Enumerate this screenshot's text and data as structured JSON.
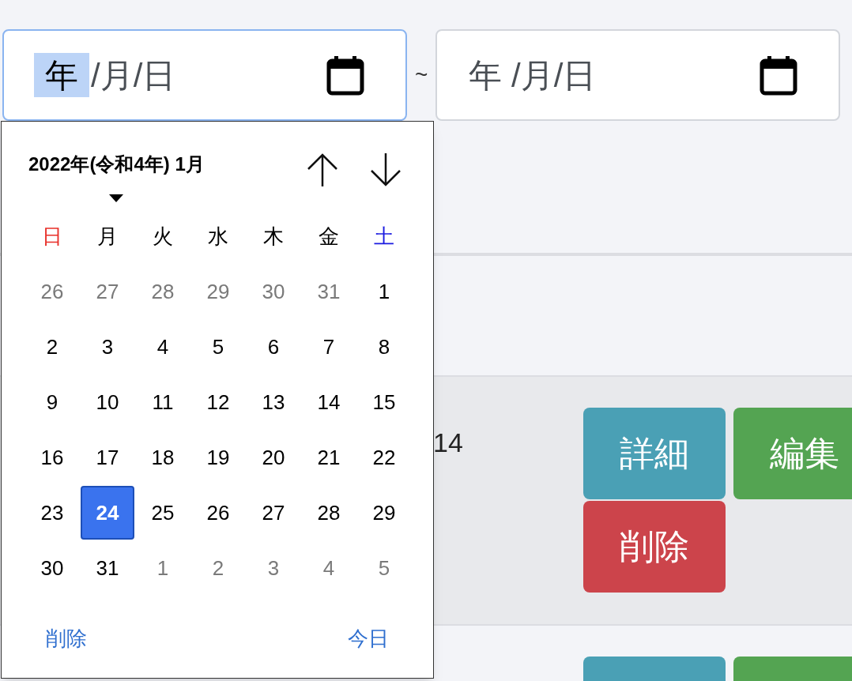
{
  "date_range": {
    "fields": [
      {
        "focused": true,
        "segments": [
          {
            "label": "年",
            "selected": true
          },
          {
            "label": "/月/日",
            "selected": false
          }
        ]
      },
      {
        "focused": false,
        "segments": [
          {
            "label": "年 /月/日",
            "selected": false
          }
        ]
      }
    ],
    "separator": "~"
  },
  "calendar": {
    "title": "2022年(令和4年) 1月",
    "weekdays": [
      {
        "label": "日",
        "color": "#e8302a"
      },
      {
        "label": "月",
        "color": "#000000"
      },
      {
        "label": "火",
        "color": "#000000"
      },
      {
        "label": "水",
        "color": "#000000"
      },
      {
        "label": "木",
        "color": "#000000"
      },
      {
        "label": "金",
        "color": "#000000"
      },
      {
        "label": "土",
        "color": "#1a1ae0"
      }
    ],
    "weeks": [
      [
        {
          "label": "26",
          "muted": true,
          "selected": false
        },
        {
          "label": "27",
          "muted": true,
          "selected": false
        },
        {
          "label": "28",
          "muted": true,
          "selected": false
        },
        {
          "label": "29",
          "muted": true,
          "selected": false
        },
        {
          "label": "30",
          "muted": true,
          "selected": false
        },
        {
          "label": "31",
          "muted": true,
          "selected": false
        },
        {
          "label": "1",
          "muted": false,
          "selected": false
        }
      ],
      [
        {
          "label": "2",
          "muted": false,
          "selected": false
        },
        {
          "label": "3",
          "muted": false,
          "selected": false
        },
        {
          "label": "4",
          "muted": false,
          "selected": false
        },
        {
          "label": "5",
          "muted": false,
          "selected": false
        },
        {
          "label": "6",
          "muted": false,
          "selected": false
        },
        {
          "label": "7",
          "muted": false,
          "selected": false
        },
        {
          "label": "8",
          "muted": false,
          "selected": false
        }
      ],
      [
        {
          "label": "9",
          "muted": false,
          "selected": false
        },
        {
          "label": "10",
          "muted": false,
          "selected": false
        },
        {
          "label": "11",
          "muted": false,
          "selected": false
        },
        {
          "label": "12",
          "muted": false,
          "selected": false
        },
        {
          "label": "13",
          "muted": false,
          "selected": false
        },
        {
          "label": "14",
          "muted": false,
          "selected": false
        },
        {
          "label": "15",
          "muted": false,
          "selected": false
        }
      ],
      [
        {
          "label": "16",
          "muted": false,
          "selected": false
        },
        {
          "label": "17",
          "muted": false,
          "selected": false
        },
        {
          "label": "18",
          "muted": false,
          "selected": false
        },
        {
          "label": "19",
          "muted": false,
          "selected": false
        },
        {
          "label": "20",
          "muted": false,
          "selected": false
        },
        {
          "label": "21",
          "muted": false,
          "selected": false
        },
        {
          "label": "22",
          "muted": false,
          "selected": false
        }
      ],
      [
        {
          "label": "23",
          "muted": false,
          "selected": false
        },
        {
          "label": "24",
          "muted": false,
          "selected": true
        },
        {
          "label": "25",
          "muted": false,
          "selected": false
        },
        {
          "label": "26",
          "muted": false,
          "selected": false
        },
        {
          "label": "27",
          "muted": false,
          "selected": false
        },
        {
          "label": "28",
          "muted": false,
          "selected": false
        },
        {
          "label": "29",
          "muted": false,
          "selected": false
        }
      ],
      [
        {
          "label": "30",
          "muted": false,
          "selected": false
        },
        {
          "label": "31",
          "muted": false,
          "selected": false
        },
        {
          "label": "1",
          "muted": true,
          "selected": false
        },
        {
          "label": "2",
          "muted": true,
          "selected": false
        },
        {
          "label": "3",
          "muted": true,
          "selected": false
        },
        {
          "label": "4",
          "muted": true,
          "selected": false
        },
        {
          "label": "5",
          "muted": true,
          "selected": false
        }
      ]
    ],
    "footer": {
      "clear": "削除",
      "today": "今日"
    }
  },
  "table": {
    "rows": [
      {
        "date": "14",
        "buttons": [
          {
            "kind": "detail",
            "label": "詳細"
          },
          {
            "kind": "edit",
            "label": "編集"
          },
          {
            "kind": "delete",
            "label": "削除"
          }
        ]
      },
      {
        "buttons": [
          {
            "kind": "detail"
          },
          {
            "kind": "edit"
          }
        ]
      }
    ]
  }
}
